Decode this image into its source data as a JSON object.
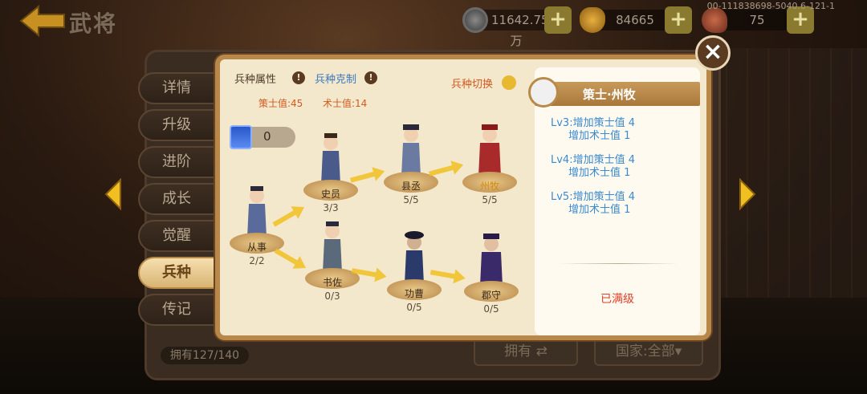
{
  "header": {
    "title": "武将",
    "version_id": "00-11183869​8-5040.6-121-1",
    "resources": [
      {
        "name": "coin",
        "icon": "coin-icon",
        "value": "11642.75万"
      },
      {
        "name": "gold",
        "icon": "gold-ingot-icon",
        "value": "84665"
      },
      {
        "name": "stamina",
        "icon": "drumstick-icon",
        "value": "75"
      }
    ],
    "plus_label": "+"
  },
  "tabs": [
    {
      "label": "详情",
      "active": false
    },
    {
      "label": "升级",
      "active": false
    },
    {
      "label": "进阶",
      "active": false
    },
    {
      "label": "成长",
      "active": false
    },
    {
      "label": "觉醒",
      "active": false
    },
    {
      "label": "兵种",
      "active": true
    },
    {
      "label": "传记",
      "active": false
    }
  ],
  "panel": {
    "attr_label": "兵种属性",
    "counter_label": "兵种克制",
    "info_mark": "!",
    "switch_label": "兵种切换",
    "stat_strategist": "策士值:45",
    "stat_tactician": "术士值:14",
    "gem_count": "0"
  },
  "tree": {
    "nodes": [
      {
        "name": "从事",
        "count": "2/2",
        "highlight": false
      },
      {
        "name": "史员",
        "count": "3/3",
        "highlight": false
      },
      {
        "name": "县丞",
        "count": "5/5",
        "highlight": false
      },
      {
        "name": "州牧",
        "count": "5/5",
        "highlight": true
      },
      {
        "name": "书佐",
        "count": "0/3",
        "highlight": false
      },
      {
        "name": "功曹",
        "count": "0/5",
        "highlight": false
      },
      {
        "name": "郡守",
        "count": "0/5",
        "highlight": false
      }
    ]
  },
  "detail": {
    "title": "策士·州牧",
    "levels": [
      {
        "line1": "Lv3:增加策士值 4",
        "line2": "增加术士值 1"
      },
      {
        "line1": "Lv4:增加策士值 4",
        "line2": "增加术士值 1"
      },
      {
        "line1": "Lv5:增加策士值 4",
        "line2": "增加术士值 1"
      }
    ],
    "status": "已满级"
  },
  "footer": {
    "owned": "拥有127/140",
    "own_button": "拥有 ⇄",
    "country_button": "国家:全部▾"
  },
  "colors": {
    "accent_gold": "#d48a10",
    "level_text": "#3a8ad0",
    "status_red": "#e0402a",
    "arrow_yellow": "#f0c020"
  }
}
